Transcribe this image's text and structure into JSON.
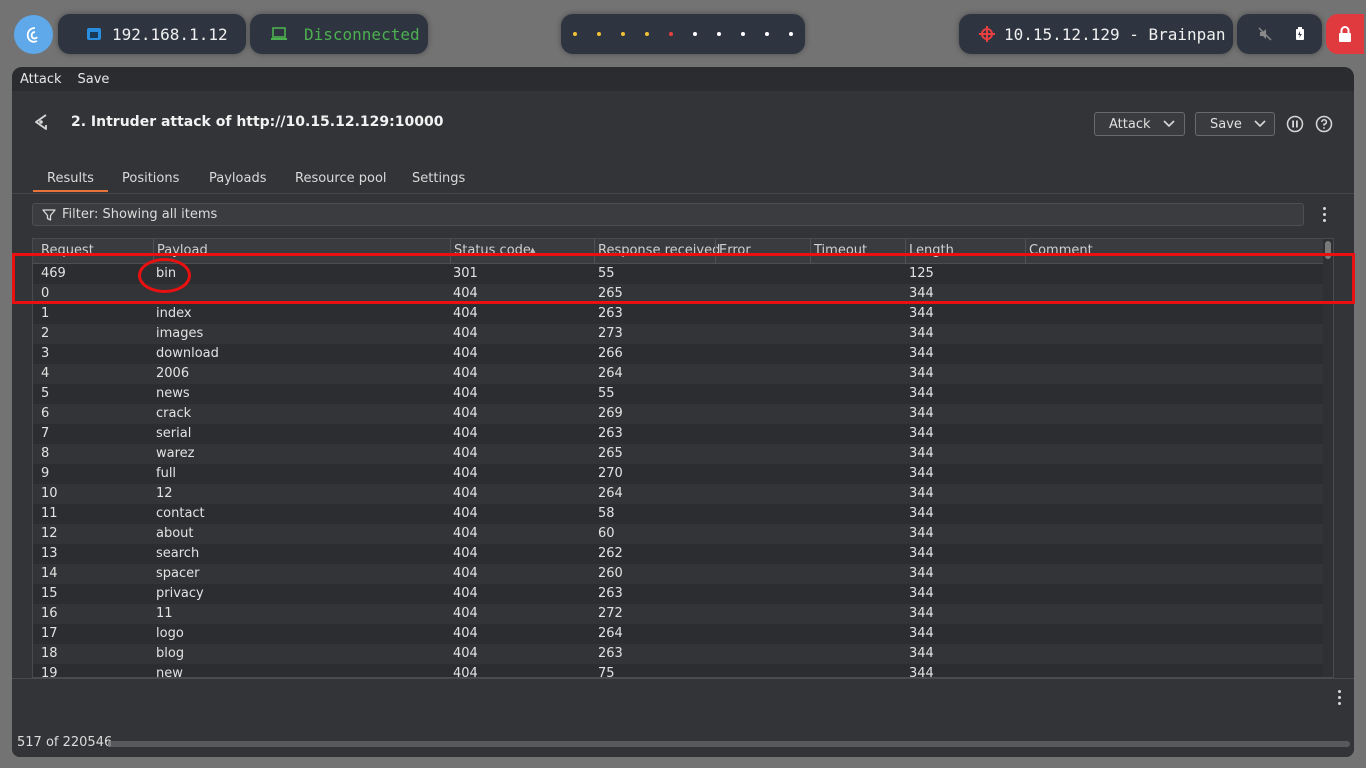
{
  "taskbar": {
    "ip_label": "192.168.1.12",
    "vpn_status": "Disconnected",
    "target_label": "10.15.12.129 - Brainpan",
    "workspace_dots": [
      "#f2c037",
      "#f2c037",
      "#f2c037",
      "#f2c037",
      "#e84040",
      "#ffffff",
      "#ffffff",
      "#ffffff",
      "#ffffff",
      "#ffffff"
    ]
  },
  "menu": {
    "attack": "Attack",
    "save": "Save"
  },
  "header": {
    "title": "2. Intruder attack of http://10.15.12.129:10000",
    "attack_button": "Attack",
    "save_button": "Save"
  },
  "tabs": [
    "Results",
    "Positions",
    "Payloads",
    "Resource pool",
    "Settings"
  ],
  "filter": {
    "text": "Filter: Showing all items"
  },
  "table": {
    "columns": [
      "Request",
      "Payload",
      "Status code",
      "Response received",
      "Error",
      "Timeout",
      "Length",
      "Comment"
    ],
    "sort_indicator": "▲",
    "rows": [
      [
        "469",
        "bin",
        "301",
        "55",
        "",
        "",
        "125",
        ""
      ],
      [
        "0",
        "",
        "404",
        "265",
        "",
        "",
        "344",
        ""
      ],
      [
        "1",
        "index",
        "404",
        "263",
        "",
        "",
        "344",
        ""
      ],
      [
        "2",
        "images",
        "404",
        "273",
        "",
        "",
        "344",
        ""
      ],
      [
        "3",
        "download",
        "404",
        "266",
        "",
        "",
        "344",
        ""
      ],
      [
        "4",
        "2006",
        "404",
        "264",
        "",
        "",
        "344",
        ""
      ],
      [
        "5",
        "news",
        "404",
        "55",
        "",
        "",
        "344",
        ""
      ],
      [
        "6",
        "crack",
        "404",
        "269",
        "",
        "",
        "344",
        ""
      ],
      [
        "7",
        "serial",
        "404",
        "263",
        "",
        "",
        "344",
        ""
      ],
      [
        "8",
        "warez",
        "404",
        "265",
        "",
        "",
        "344",
        ""
      ],
      [
        "9",
        "full",
        "404",
        "270",
        "",
        "",
        "344",
        ""
      ],
      [
        "10",
        "12",
        "404",
        "264",
        "",
        "",
        "344",
        ""
      ],
      [
        "11",
        "contact",
        "404",
        "58",
        "",
        "",
        "344",
        ""
      ],
      [
        "12",
        "about",
        "404",
        "60",
        "",
        "",
        "344",
        ""
      ],
      [
        "13",
        "search",
        "404",
        "262",
        "",
        "",
        "344",
        ""
      ],
      [
        "14",
        "spacer",
        "404",
        "260",
        "",
        "",
        "344",
        ""
      ],
      [
        "15",
        "privacy",
        "404",
        "263",
        "",
        "",
        "344",
        ""
      ],
      [
        "16",
        "11",
        "404",
        "272",
        "",
        "",
        "344",
        ""
      ],
      [
        "17",
        "logo",
        "404",
        "264",
        "",
        "",
        "344",
        ""
      ],
      [
        "18",
        "blog",
        "404",
        "263",
        "",
        "",
        "344",
        ""
      ],
      [
        "19",
        "new",
        "404",
        "75",
        "",
        "",
        "344",
        ""
      ]
    ]
  },
  "progress": {
    "label": "517 of 220546",
    "fraction": 0.00234
  },
  "colors": {
    "accent_tab": "#e8743b",
    "annotation": "#e81010",
    "vpn": "#4caf50"
  }
}
